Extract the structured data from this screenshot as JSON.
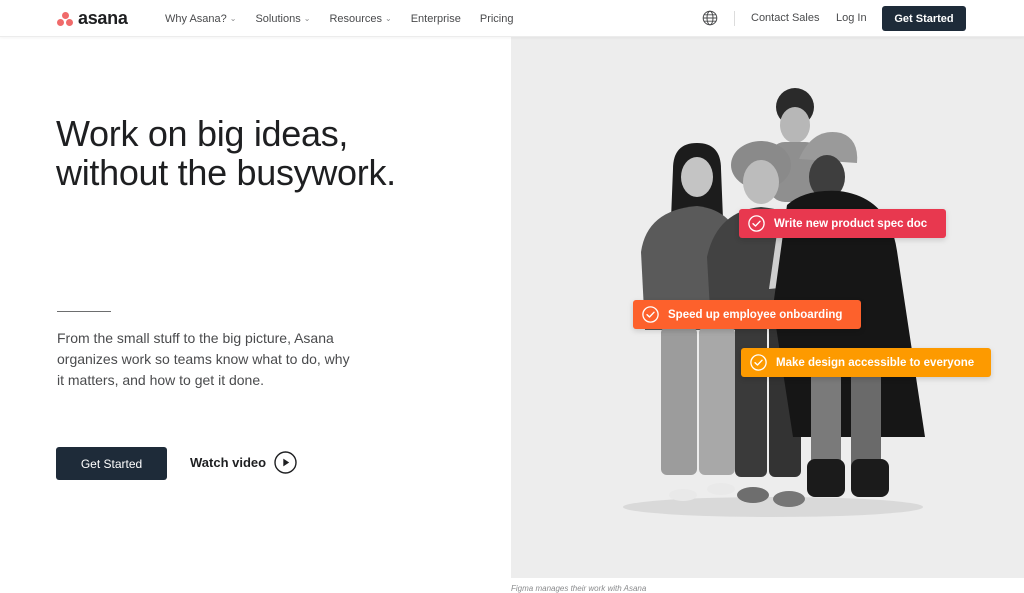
{
  "nav": {
    "brand": "asana",
    "items": [
      {
        "label": "Why Asana?",
        "has_caret": true
      },
      {
        "label": "Solutions",
        "has_caret": true
      },
      {
        "label": "Resources",
        "has_caret": true
      },
      {
        "label": "Enterprise",
        "has_caret": false
      },
      {
        "label": "Pricing",
        "has_caret": false
      }
    ],
    "caret_glyph": "⌄",
    "globe_icon": "globe-icon",
    "contact_sales": "Contact Sales",
    "log_in": "Log In",
    "get_started": "Get Started"
  },
  "hero": {
    "title_line1": "Work on big ideas,",
    "title_line2": "without the busywork.",
    "body": "From the small stuff to the big picture, Asana organizes work so teams know what to do, why it matters, and how to get it done.",
    "cta_primary": "Get Started",
    "cta_video": "Watch video",
    "play_icon": "play-circle-icon"
  },
  "tasks": [
    {
      "label": "Write new product spec doc",
      "color": "#e8384f",
      "icon": "check-circle-icon"
    },
    {
      "label": "Speed up employee onboarding",
      "color": "#fd612c",
      "icon": "check-circle-icon"
    },
    {
      "label": "Make design accessible to everyone",
      "color": "#fd9a00",
      "icon": "check-circle-icon"
    }
  ],
  "caption": "Figma manages their work with Asana",
  "colors": {
    "brand_coral": "#f06a6a",
    "dark_button": "#1e2b39",
    "panel_bg": "#ededed"
  }
}
